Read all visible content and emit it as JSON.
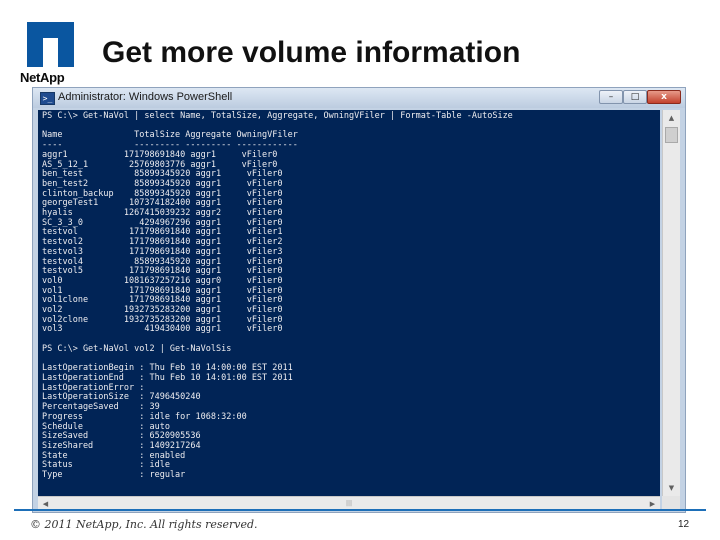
{
  "slide": {
    "title": "Get more volume information",
    "logo_text": "NetApp",
    "footer": {
      "copyright": "© 2011 NetApp, Inc. All rights reserved.",
      "page_number": "12"
    }
  },
  "window": {
    "title": "Administrator: Windows PowerShell",
    "buttons": {
      "minimize": "–",
      "maximize": "□",
      "close": "x"
    },
    "console_lines": [
      "PS C:\\> Get-NaVol | select Name, TotalSize, Aggregate, OwningVFiler | Format-Table -AutoSize",
      "",
      "Name              TotalSize Aggregate OwningVFiler",
      "----              --------- --------- ------------",
      "aggr1           171798691840 aggr1     vFiler0",
      "AS_5_12_1        25769803776 aggr1     vFiler0",
      "ben_test          85899345920 aggr1     vFiler0",
      "ben_test2         85899345920 aggr1     vFiler0",
      "clinton_backup    85899345920 aggr1     vFiler0",
      "georgeTest1      107374182400 aggr1     vFiler0",
      "hyalis          1267415039232 aggr2     vFiler0",
      "SC_3_3_0           4294967296 aggr1     vFiler0",
      "testvol          171798691840 aggr1     vFiler1",
      "testvol2         171798691840 aggr1     vFiler2",
      "testvol3         171798691840 aggr1     vFiler3",
      "testvol4          85899345920 aggr1     vFiler0",
      "testvol5         171798691840 aggr1     vFiler0",
      "vol0            1081637257216 aggr0     vFiler0",
      "vol1             171798691840 aggr1     vFiler0",
      "vol1clone        171798691840 aggr1     vFiler0",
      "vol2            1932735283200 aggr1     vFiler0",
      "vol2clone       1932735283200 aggr1     vFiler0",
      "vol3                419430400 aggr1     vFiler0",
      "",
      "PS C:\\> Get-NaVol vol2 | Get-NaVolSis",
      "",
      "LastOperationBegin : Thu Feb 10 14:00:00 EST 2011",
      "LastOperationEnd   : Thu Feb 10 14:01:00 EST 2011",
      "LastOperationError :",
      "LastOperationSize  : 7496450240",
      "PercentageSaved    : 39",
      "Progress           : idle for 1068:32:00",
      "Schedule           : auto",
      "SizeSaved          : 6520905536",
      "SizeShared         : 1409217264",
      "State              : enabled",
      "Status             : idle",
      "Type               : regular"
    ]
  },
  "icons": {
    "app": "powershell-icon",
    "logo": "netapp-logo-icon",
    "scroll_up": "scroll-up-arrow-icon",
    "scroll_down": "scroll-down-arrow-icon",
    "scroll_left": "scroll-left-arrow-icon",
    "scroll_right": "scroll-right-arrow-icon"
  },
  "colors": {
    "console_background": "#012456",
    "console_text": "#eeedf0",
    "footer_rule": "#1d6fb8",
    "logo": "#0a56a0"
  }
}
